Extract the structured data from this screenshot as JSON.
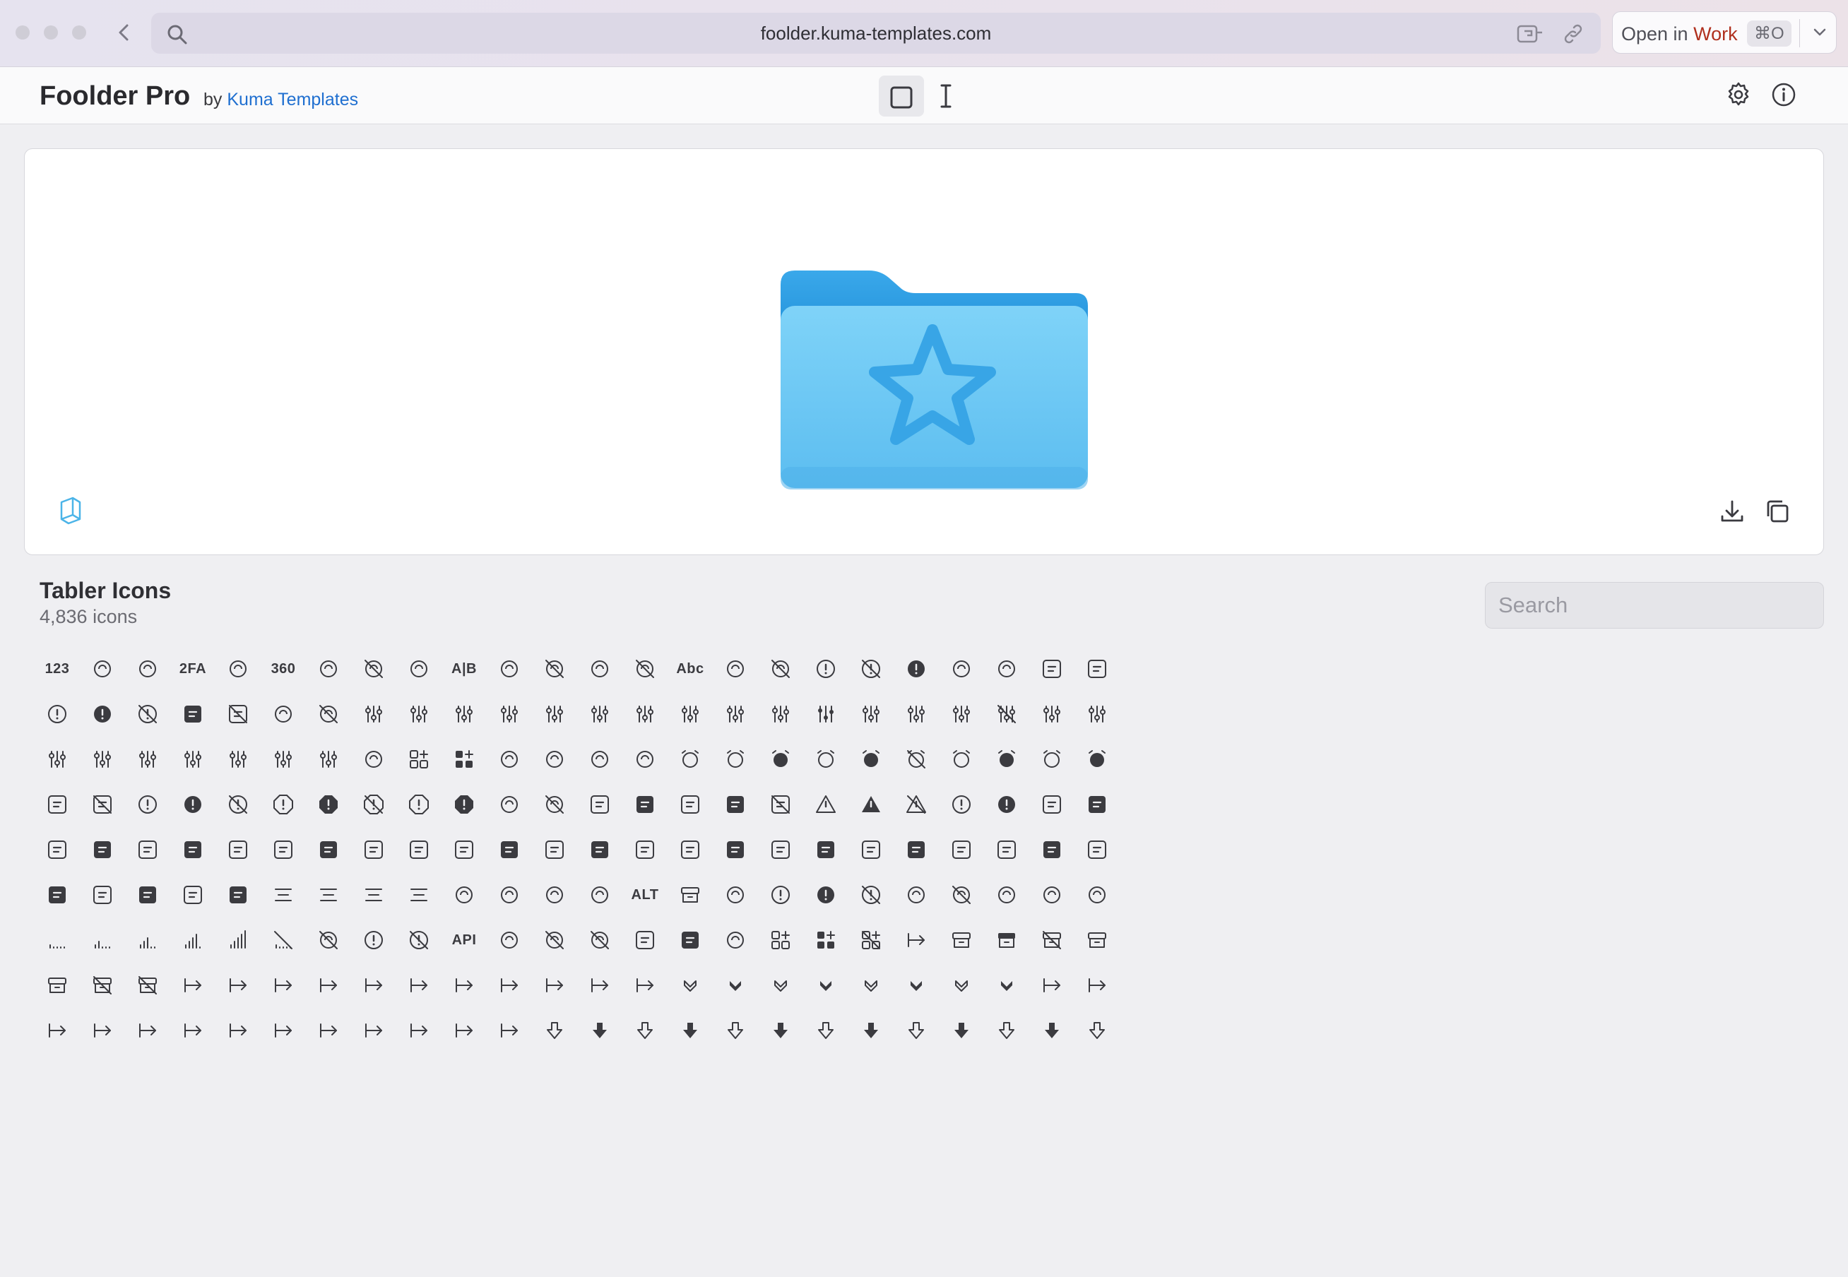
{
  "browser": {
    "url": "foolder.kuma-templates.com",
    "open_in_prefix": "Open in",
    "open_in_target": "Work",
    "open_in_shortcut": "⌘O"
  },
  "header": {
    "title": "Foolder Pro",
    "by": "by",
    "author": "Kuma Templates"
  },
  "preview": {
    "folder_color": "#6cc7f3",
    "folder_back_color": "#2f9fe2",
    "symbol": "star-icon"
  },
  "section": {
    "title": "Tabler Icons",
    "count": "4,836 icons",
    "search_placeholder": "Search"
  },
  "icons": [
    [
      "123",
      "rotate-12-icon",
      "rotate-24-icon",
      "2FA",
      "rotate-back-icon",
      "360",
      "focus-icon",
      "focus-off-icon",
      "3d-rotate-icon",
      "A|B",
      "ab-2-icon",
      "ab-off-icon",
      "abacus-icon",
      "abacus-off-icon",
      "Abc",
      "access-point-icon",
      "access-point-off-icon",
      "accessible-icon",
      "accessible-off-icon",
      "accessible-filled-icon",
      "activity-icon",
      "activity-heartbeat-icon",
      "ad-icon",
      "ad-2-icon"
    ],
    [
      "ad-circle-icon",
      "ad-circle-filled-icon",
      "ad-circle-off-icon",
      "ad-filled-icon",
      "ad-off-icon",
      "address-book-icon",
      "address-book-off-icon",
      "adjustments-icon",
      "adjustments-alt-icon",
      "adjustments-bolt-icon",
      "adjustments-cancel-icon",
      "adjustments-check-icon",
      "adjustments-code-icon",
      "adjustments-cog-icon",
      "adjustments-dollar-icon",
      "adjustments-down-icon",
      "adjustments-exclamation-icon",
      "adjustments-filled-icon",
      "adjustments-heart-icon",
      "adjustments-horizontal-icon",
      "adjustments-minus-icon",
      "adjustments-off-icon",
      "adjustments-pause-icon",
      "adjustments-pin-icon"
    ],
    [
      "adjustments-plus-icon",
      "adjustments-question-icon",
      "adjustments-search-icon",
      "adjustments-share-icon",
      "adjustments-star-icon",
      "adjustments-up-icon",
      "adjustments-x-icon",
      "aerial-lift-icon",
      "affiliate-icon",
      "affiliate-filled-icon",
      "air-balloon-icon",
      "air-conditioning-icon",
      "air-conditioning-disabled-icon",
      "air-traffic-control-icon",
      "alarm-icon",
      "alarm-average-icon",
      "alarm-filled-icon",
      "alarm-minus-icon",
      "alarm-minus-filled-icon",
      "alarm-off-icon",
      "alarm-plus-icon",
      "alarm-plus-filled-icon",
      "alarm-snooze-icon",
      "alarm-snooze-filled-icon"
    ],
    [
      "album-icon",
      "album-off-icon",
      "alert-circle-icon",
      "alert-circle-filled-icon",
      "alert-circle-off-icon",
      "alert-hexagon-icon",
      "alert-hexagon-filled-icon",
      "alert-hexagon-off-icon",
      "alert-octagon-icon",
      "alert-octagon-filled-icon",
      "alert-small-icon",
      "alert-small-off-icon",
      "alert-square-icon",
      "alert-square-filled-icon",
      "alert-square-rounded-icon",
      "alert-square-rounded-filled-icon",
      "alert-square-rounded-off-icon",
      "alert-triangle-icon",
      "alert-triangle-filled-icon",
      "alert-triangle-off-icon",
      "alien-icon",
      "alien-filled-icon",
      "align-box-bottom-center-icon",
      "align-box-bottom-center-filled-icon"
    ],
    [
      "align-box-bottom-left-icon",
      "align-box-bottom-left-filled-icon",
      "align-box-bottom-right-icon",
      "align-box-bottom-right-filled-icon",
      "align-box-center-bottom-icon",
      "align-box-center-middle-icon",
      "align-box-center-middle-filled-icon",
      "align-box-center-stretch-icon",
      "align-box-center-top-icon",
      "align-box-left-bottom-icon",
      "align-box-left-bottom-filled-icon",
      "align-box-left-middle-icon",
      "align-box-left-middle-filled-icon",
      "align-box-left-stretch-icon",
      "align-box-left-top-icon",
      "align-box-left-top-filled-icon",
      "align-box-right-bottom-icon",
      "align-box-right-bottom-filled-icon",
      "align-box-right-middle-icon",
      "align-box-right-middle-filled-icon",
      "align-box-right-stretch-icon",
      "align-box-right-top-icon",
      "align-box-right-top-filled-icon",
      "align-box-top-center-icon"
    ],
    [
      "align-box-top-center-filled-icon",
      "align-box-top-left-icon",
      "align-box-top-left-filled-icon",
      "align-box-top-right-icon",
      "align-box-top-right-filled-icon",
      "align-center-icon",
      "align-justified-icon",
      "align-left-icon",
      "align-right-icon",
      "alpha-icon",
      "alphabet-cyrillic-icon",
      "alphabet-greek-icon",
      "alphabet-latin-icon",
      "ALT",
      "ambulance-icon",
      "ampersand-icon",
      "analyze-icon",
      "analyze-filled-icon",
      "analyze-off-icon",
      "anchor-icon",
      "anchor-off-icon",
      "angle-icon",
      "ankh-icon",
      "antenna-icon"
    ],
    [
      "antenna-bars-1-icon",
      "antenna-bars-2-icon",
      "antenna-bars-3-icon",
      "antenna-bars-4-icon",
      "antenna-bars-5-icon",
      "antenna-bars-off-icon",
      "antenna-off-icon",
      "aperture-icon",
      "aperture-off-icon",
      "API",
      "api-app-icon",
      "api-app-off-icon",
      "api-off-icon",
      "app-window-icon",
      "app-window-filled-icon",
      "apple-icon",
      "apps-icon",
      "apps-filled-icon",
      "apps-off-icon",
      "archery-arrow-icon",
      "archive-icon",
      "archive-filled-icon",
      "archive-off-icon",
      "armchair-icon"
    ],
    [
      "armchair-2-icon",
      "armchair-2-off-icon",
      "armchair-off-icon",
      "arrow-autofit-content-icon",
      "arrow-autofit-content-filled-icon",
      "arrow-autofit-down-icon",
      "arrow-autofit-height-icon",
      "arrow-autofit-left-icon",
      "arrow-autofit-right-icon",
      "arrow-autofit-up-icon",
      "arrow-autofit-width-icon",
      "arrow-back-icon",
      "arrow-back-up-icon",
      "arrow-back-up-double-icon",
      "arrow-badge-down-icon",
      "arrow-badge-down-filled-icon",
      "arrow-badge-left-icon",
      "arrow-badge-left-filled-icon",
      "arrow-badge-right-icon",
      "arrow-badge-right-filled-icon",
      "arrow-badge-up-icon",
      "arrow-badge-up-filled-icon",
      "arrow-bar-both-icon",
      "arrow-bar-down-icon"
    ],
    [
      "arrow-bar-left-icon",
      "arrow-bar-right-icon",
      "arrow-bar-to-down-icon",
      "arrow-bar-to-left-icon",
      "arrow-bar-to-right-icon",
      "arrow-bar-to-up-icon",
      "arrow-bar-up-icon",
      "arrow-bear-left-icon",
      "arrow-bear-left-2-icon",
      "arrow-bear-right-icon",
      "arrow-bear-right-2-icon",
      "arrow-big-down-icon",
      "arrow-big-down-filled-icon",
      "arrow-big-down-line-icon",
      "arrow-big-down-line-filled-icon",
      "arrow-big-down-lines-icon",
      "arrow-big-down-lines-filled-icon",
      "arrow-big-left-icon",
      "arrow-big-left-filled-icon",
      "arrow-big-left-line-icon",
      "arrow-big-left-line-filled-icon",
      "arrow-big-left-lines-icon",
      "arrow-big-left-lines-filled-icon",
      "arrow-big-right-icon"
    ]
  ],
  "colors": {
    "icon": "#3b3b40",
    "link": "#1f6fd0",
    "work": "#b0301e"
  }
}
